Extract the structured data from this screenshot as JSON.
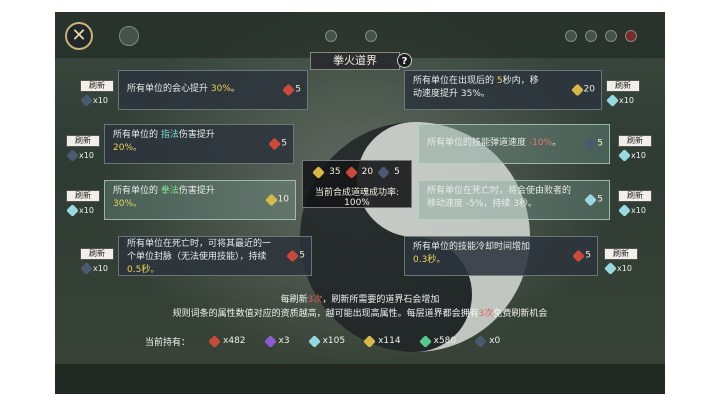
{
  "title": "拳火道界",
  "refresh_label": "刷新",
  "cards": [
    {
      "pre": "所有单位的会心提升 ",
      "hl": "30%",
      "post": "。",
      "hl_class": "hl-yellow",
      "cost": "5",
      "cost_stone": "st-red",
      "refresh": "x10",
      "line2": ""
    },
    {
      "pre": "所有单位在出现后的 ",
      "hl": "5",
      "post": "秒内，移",
      "hl_class": "hl-yellow",
      "line2": "动速度提升 35%。",
      "cost": "20",
      "cost_stone": "st-gold",
      "refresh": "x10"
    },
    {
      "pre": "所有单位的 ",
      "hl": "指法",
      "post": "伤害提升",
      "hl_class": "hl-teal",
      "line2": "20%。",
      "cost": "5",
      "cost_stone": "st-red",
      "refresh": "x10"
    },
    {
      "pre": "所有单位的技能弹道速度 ",
      "hl": "-10%",
      "post": "。",
      "hl_class": "hl-red",
      "cost": "5",
      "cost_stone": "st-dark",
      "refresh": "x10",
      "line2": ""
    },
    {
      "pre": "所有单位的 ",
      "hl": "拳法",
      "post": "伤害提升",
      "hl_class": "hl-green",
      "line2": "30%。",
      "cost": "10",
      "cost_stone": "st-gold",
      "refresh": "x10"
    },
    {
      "pre": "所有单位在死亡时，将会使由败者的",
      "hl": "",
      "post": "",
      "hl_class": "hl-yellow",
      "line2": "移动速度 -5%，持续 3秒。",
      "cost": "5",
      "cost_stone": "st-cyan",
      "refresh": "x10"
    },
    {
      "pre": "所有单位在死亡时，可将其最近的一",
      "hl": "",
      "post": "",
      "hl_class": "hl-yellow",
      "line2": "个单位封脉（无法使用技能），持续",
      "line3": "0.5秒。",
      "cost": "5",
      "cost_stone": "st-red",
      "refresh": "x10"
    },
    {
      "pre": "所有单位的技能冷却时间增加",
      "hl": "",
      "post": "",
      "hl_class": "hl-yellow",
      "line2": "0.3秒。",
      "cost": "5",
      "cost_stone": "st-red",
      "refresh": "x10"
    }
  ],
  "center": {
    "cost1": "35",
    "cost2": "20",
    "cost3": "5",
    "rate": "当前合成道魂成功率: 100%"
  },
  "info": {
    "line1_a": "每刷新",
    "line1_b": "3次",
    "line1_c": "，刷新所需要的道界石会增加",
    "line2_a": "规则词条的属性数值对应的资质越高，越可能出现高属性。每层道界都会拥有",
    "line2_b": "3次",
    "line2_c": "免费刷新机会"
  },
  "holdings_label": "当前持有：",
  "holdings": [
    {
      "color": "st-red",
      "count": "x482"
    },
    {
      "color": "st-purple",
      "count": "x3"
    },
    {
      "color": "st-cyan",
      "count": "x105"
    },
    {
      "color": "st-gold",
      "count": "x114"
    },
    {
      "color": "st-green",
      "count": "x580"
    },
    {
      "color": "st-dark",
      "count": "x0"
    }
  ]
}
